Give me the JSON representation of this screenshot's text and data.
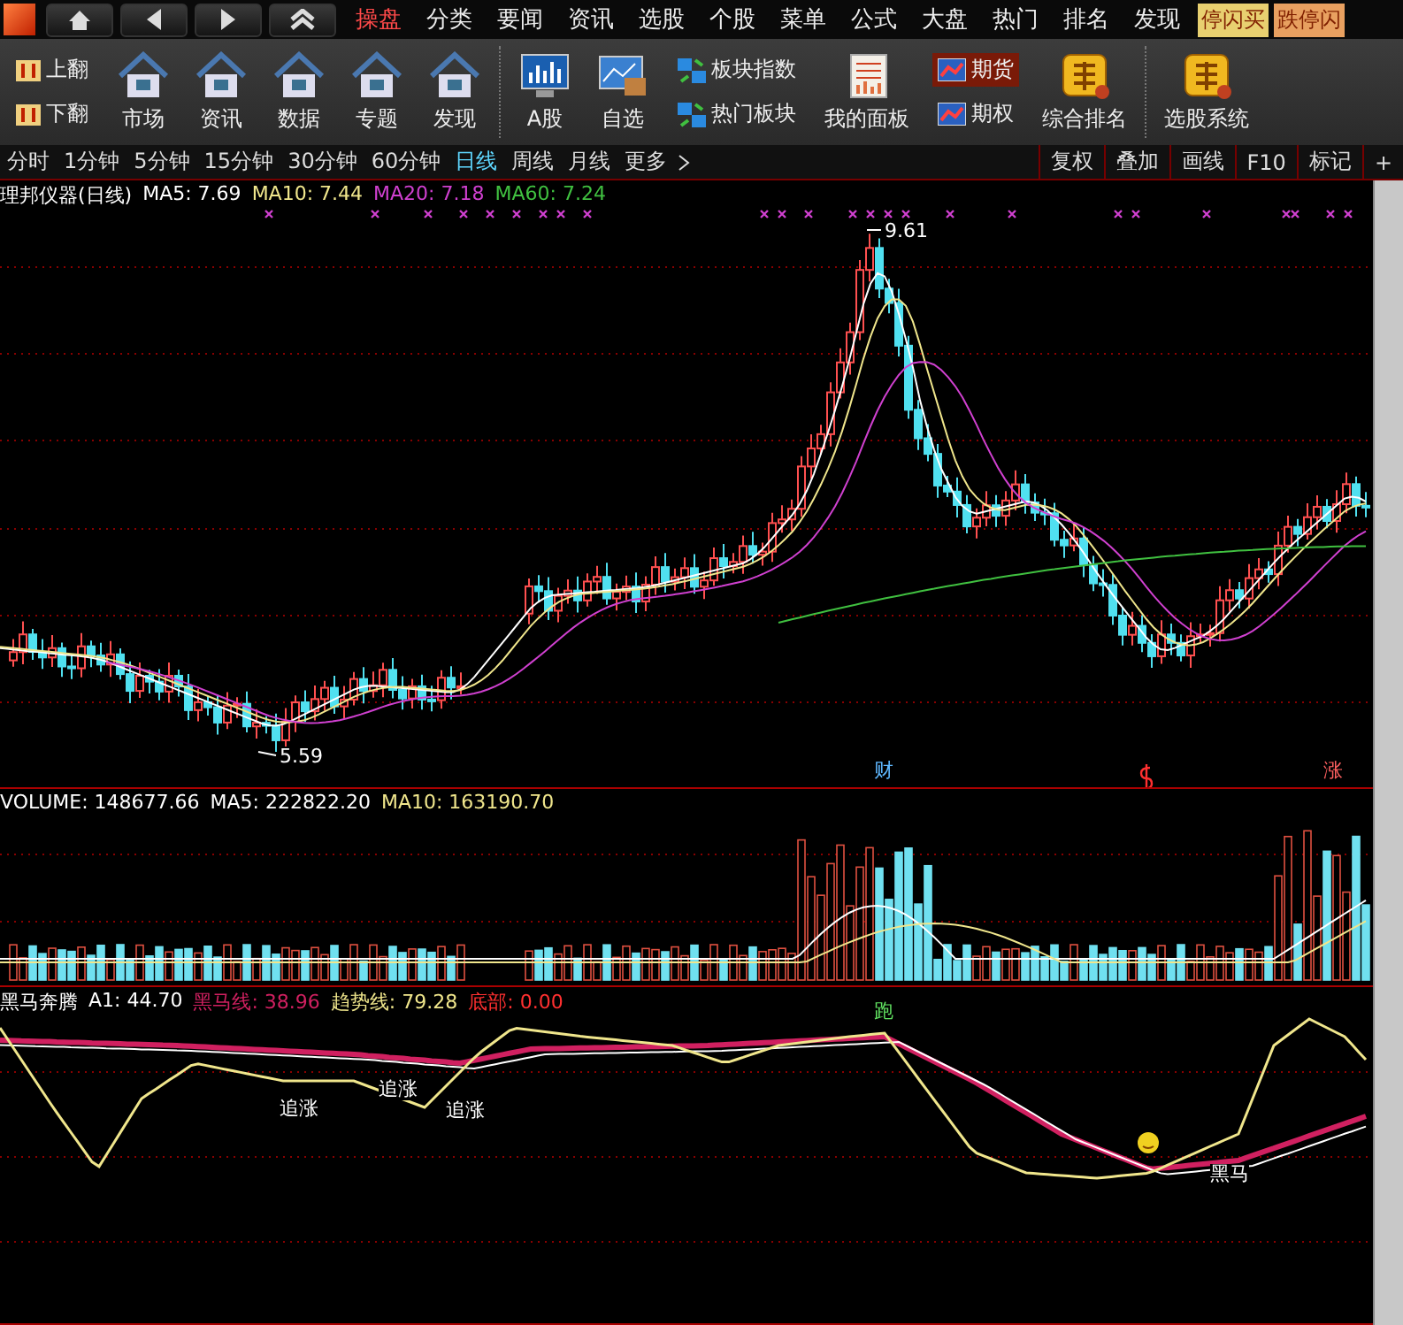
{
  "menu": [
    {
      "label": "操盘",
      "selected": true
    },
    {
      "label": "分类",
      "selected": false
    },
    {
      "label": "要闻",
      "selected": false
    },
    {
      "label": "资讯",
      "selected": false
    },
    {
      "label": "选股",
      "selected": false
    },
    {
      "label": "个股",
      "selected": false
    },
    {
      "label": "菜单",
      "selected": false
    },
    {
      "label": "公式",
      "selected": false
    },
    {
      "label": "大盘",
      "selected": false
    },
    {
      "label": "热门",
      "selected": false
    },
    {
      "label": "排名",
      "selected": false
    },
    {
      "label": "发现",
      "selected": false
    }
  ],
  "alert_badges": [
    "停闪买",
    "跌停闪"
  ],
  "toolbar": [
    {
      "kind": "stack",
      "items": [
        {
          "label": "上翻",
          "kind": "flip",
          "selected": false
        },
        {
          "label": "下翻",
          "kind": "flip",
          "selected": false
        }
      ]
    },
    {
      "kind": "house",
      "label": "市场"
    },
    {
      "kind": "house",
      "label": "资讯"
    },
    {
      "kind": "house",
      "label": "数据"
    },
    {
      "kind": "house",
      "label": "专题"
    },
    {
      "kind": "house",
      "label": "发现"
    },
    {
      "kind": "sep"
    },
    {
      "kind": "monitor",
      "label": "A股"
    },
    {
      "kind": "picture",
      "label": "自选"
    },
    {
      "kind": "stack",
      "items": [
        {
          "label": "板块指数",
          "kind": "blocks",
          "selected": false
        },
        {
          "label": "热门板块",
          "kind": "blocks",
          "selected": false
        }
      ]
    },
    {
      "kind": "doc",
      "label": "我的面板"
    },
    {
      "kind": "stack",
      "items": [
        {
          "label": "期货",
          "kind": "chart",
          "selected": true
        },
        {
          "label": "期权",
          "kind": "chart",
          "selected": false
        }
      ]
    },
    {
      "kind": "week",
      "label": "综合排名"
    },
    {
      "kind": "sep"
    },
    {
      "kind": "week",
      "label": "选股系统"
    }
  ],
  "periods": [
    {
      "label": "分时",
      "selected": false
    },
    {
      "label": "1分钟",
      "selected": false
    },
    {
      "label": "5分钟",
      "selected": false
    },
    {
      "label": "15分钟",
      "selected": false
    },
    {
      "label": "30分钟",
      "selected": false
    },
    {
      "label": "60分钟",
      "selected": false
    },
    {
      "label": "日线",
      "selected": true
    },
    {
      "label": "周线",
      "selected": false
    },
    {
      "label": "月线",
      "selected": false
    },
    {
      "label": "更多",
      "selected": false
    }
  ],
  "chart_buttons": [
    "复权",
    "叠加",
    "画线",
    "F10",
    "标记",
    "+"
  ],
  "price_panel": {
    "title": "理邦仪器(日线)",
    "legend": [
      {
        "label": "MA5: 7.69",
        "color": "#ffffff"
      },
      {
        "label": "MA10: 7.44",
        "color": "#f0e68c"
      },
      {
        "label": "MA20: 7.18",
        "color": "#d040d0"
      },
      {
        "label": "MA60: 7.24",
        "color": "#40c040"
      }
    ],
    "high_label": "9.61",
    "low_label": "5.59",
    "events": [
      {
        "label": "财",
        "color": "#5fb8ff"
      },
      {
        "label": "涨",
        "color": "#ff6060"
      }
    ]
  },
  "volume_panel": {
    "legend": [
      {
        "label": "VOLUME: 148677.66",
        "color": "#ffffff"
      },
      {
        "label": "MA5: 222822.20",
        "color": "#ffffff"
      },
      {
        "label": "MA10: 163190.70",
        "color": "#f0e68c"
      }
    ]
  },
  "indicator_panel": {
    "legend": [
      {
        "label": "黑马奔腾",
        "color": "#ffffff"
      },
      {
        "label": "A1: 44.70",
        "color": "#ffffff"
      },
      {
        "label": "黑马线: 38.96",
        "color": "#d02060"
      },
      {
        "label": "趋势线: 79.28",
        "color": "#f0e68c"
      },
      {
        "label": "底部: 0.00",
        "color": "#ff3030"
      }
    ],
    "signals": [
      {
        "label": "追涨",
        "kind": "chase"
      },
      {
        "label": "追涨",
        "kind": "chase"
      },
      {
        "label": "追涨",
        "kind": "chase"
      },
      {
        "label": "跑",
        "kind": "run"
      },
      {
        "label": "黑马",
        "kind": "horse"
      }
    ]
  }
}
